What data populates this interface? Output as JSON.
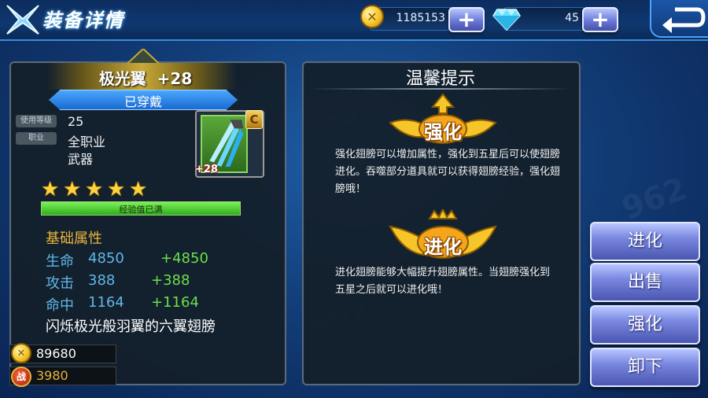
{
  "header": {
    "title": "装备详情",
    "gold": "1185153",
    "diamonds": "45",
    "add_label": "+"
  },
  "item": {
    "name": "极光翼",
    "level": "+28",
    "status": "已穿戴",
    "grade": "C",
    "plus_badge": "+28",
    "tags": {
      "level_tag": "使用等级",
      "class_tag": "职业"
    },
    "use_level": "25",
    "class_value": "全职业",
    "type_value": "武器",
    "stars": 5,
    "stars_max": 5,
    "exp_text": "经验值已满",
    "exp_percent": 100
  },
  "attributes": {
    "title": "基础属性",
    "rows": [
      {
        "name": "生命",
        "value": "4850",
        "bonus": "+4850"
      },
      {
        "name": "攻击",
        "value": "388",
        "bonus": "+388"
      },
      {
        "name": "命中",
        "value": "1164",
        "bonus": "+1164"
      }
    ]
  },
  "description": "闪烁极光般羽翼的六翼翅膀",
  "footer": {
    "gold": "89680",
    "battle_icon_label": "战",
    "battle_power": "3980"
  },
  "tips": {
    "title": "温馨提示",
    "strengthen_badge": "强化",
    "strengthen_text": "强化翅膀可以增加属性，强化到五星后可以使翅膀进化。吞噬部分道具就可以获得翅膀经验，强化翅膀哦！",
    "evolve_badge": "进化",
    "evolve_text": "进化翅膀能够大幅提升翅膀属性。当翅膀强化到五星之后就可以进化哦！"
  },
  "actions": {
    "evolve": "进化",
    "sell": "出售",
    "strengthen": "强化",
    "unequip": "卸下"
  },
  "colors": {
    "gold_text": "#e8b43a",
    "attr_name": "#5fb8e8",
    "attr_bonus": "#6ae04a",
    "button_blue": "#7a88e0"
  }
}
